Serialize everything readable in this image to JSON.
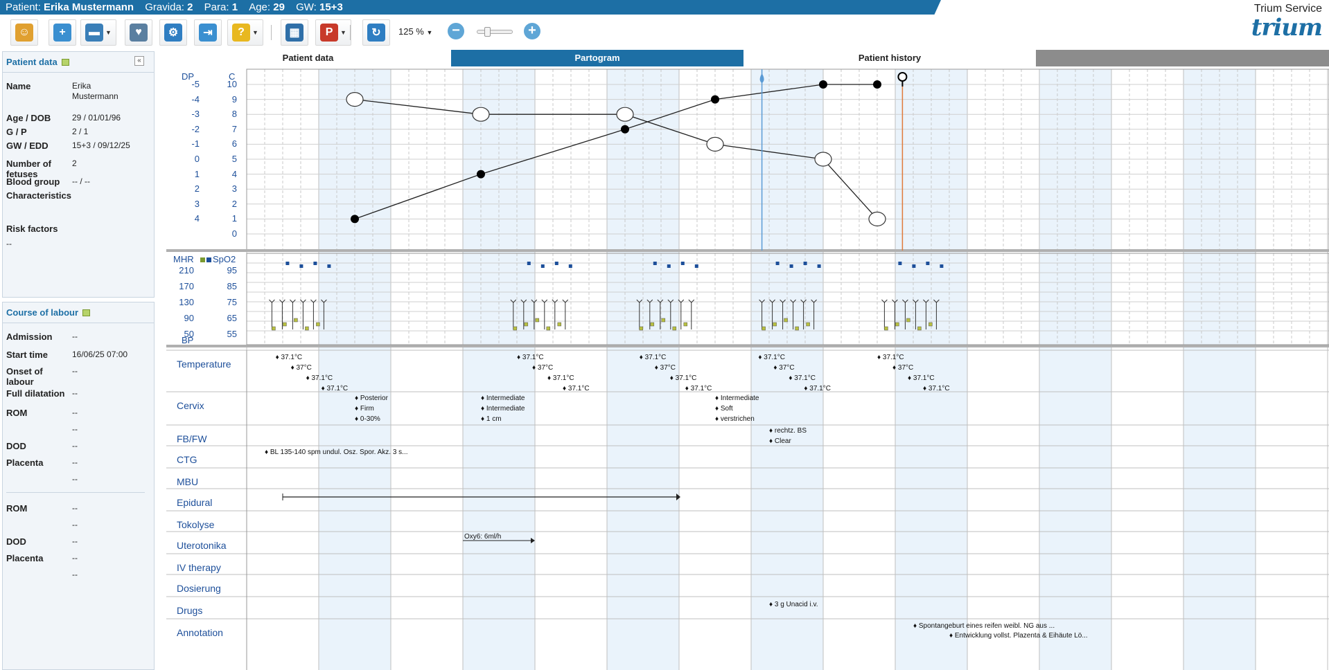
{
  "header": {
    "patient_label": "Patient:",
    "patient_name": "Erika Mustermann",
    "gravida_label": "Gravida:",
    "gravida": "2",
    "para_label": "Para:",
    "para": "1",
    "age_label": "Age:",
    "age": "29",
    "gw_label": "GW:",
    "gw": "15+3",
    "service": "Trium Service",
    "logo": "trium"
  },
  "toolbar": {
    "zoom": "125 %",
    "buttons": [
      {
        "name": "patients-icon",
        "color": "#e0a030"
      },
      {
        "name": "add-patient-icon",
        "color": "#3a8fd0"
      },
      {
        "name": "archive-icon",
        "color": "#3a7fb8"
      },
      {
        "name": "stethoscope-icon",
        "color": "#5a7fa0"
      },
      {
        "name": "gear-icon",
        "color": "#2f7ec2"
      },
      {
        "name": "logout-icon",
        "color": "#3a8fd0"
      },
      {
        "name": "help-icon",
        "color": "#e8b820"
      },
      {
        "name": "calendar-icon",
        "color": "#2f6fa8"
      },
      {
        "name": "pdf-icon",
        "color": "#c83a2a"
      },
      {
        "name": "refresh-icon",
        "color": "#2f7ec2"
      }
    ],
    "pdf_label": "PDF"
  },
  "patient_panel": {
    "title": "Patient data",
    "rows": [
      {
        "label": "Name",
        "value": "Erika\nMustermann"
      },
      {
        "label": "Age / DOB",
        "value": "29 / 01/01/96"
      },
      {
        "label": "G / P",
        "value": "2 / 1"
      },
      {
        "label": "GW / EDD",
        "value": "15+3 / 09/12/25"
      },
      {
        "label": "Number of fetuses",
        "value": "2"
      },
      {
        "label": "Blood group",
        "value": "-- / --"
      },
      {
        "label": "Characteristics",
        "value": ""
      },
      {
        "label": "Risk factors",
        "value": ""
      }
    ],
    "risk_value": "--"
  },
  "labour_panel": {
    "title": "Course of labour",
    "rows": [
      {
        "label": "Admission",
        "value": "--"
      },
      {
        "label": "Start time",
        "value": "16/06/25 07:00"
      },
      {
        "label": "Onset of labour",
        "value": "--"
      },
      {
        "label": "Full dilatation",
        "value": "--"
      },
      {
        "label": "ROM",
        "value": "--"
      },
      {
        "label": "",
        "value": "--"
      },
      {
        "label": "DOD",
        "value": "--"
      },
      {
        "label": "Placenta",
        "value": "--"
      },
      {
        "label": "",
        "value": "--"
      },
      {
        "label": "ROM",
        "value": "--"
      },
      {
        "label": "",
        "value": "--"
      },
      {
        "label": "DOD",
        "value": "--"
      },
      {
        "label": "Placenta",
        "value": "--"
      },
      {
        "label": "",
        "value": "--"
      }
    ]
  },
  "tabs": [
    {
      "label": "Patient data",
      "active": false
    },
    {
      "label": "Partogram",
      "active": true
    },
    {
      "label": "Patient history",
      "active": false
    }
  ],
  "partogram": {
    "dp_label": "DP",
    "c_label": "C",
    "dp_ticks": [
      "-5",
      "-4",
      "-3",
      "-2",
      "-1",
      "0",
      "1",
      "2",
      "3",
      "4"
    ],
    "c_ticks": [
      "10",
      "9",
      "8",
      "7",
      "6",
      "5",
      "4",
      "3",
      "2",
      "1",
      "0"
    ],
    "dilatation": [
      {
        "t": 1.5,
        "c": 1
      },
      {
        "t": 3.25,
        "c": 4
      },
      {
        "t": 5.25,
        "c": 7
      },
      {
        "t": 6.5,
        "c": 9
      },
      {
        "t": 8,
        "c": 10
      },
      {
        "t": 8.75,
        "c": 10
      }
    ],
    "descent": [
      {
        "t": 1.5,
        "c": 9
      },
      {
        "t": 3.25,
        "c": 8
      },
      {
        "t": 5.25,
        "c": 8
      },
      {
        "t": 6.5,
        "c": 6
      },
      {
        "t": 8,
        "c": 5
      },
      {
        "t": 8.75,
        "c": 1
      }
    ],
    "birth_marker_t": 9.1,
    "rom_marker_t": 7.15
  },
  "vitals": {
    "mhr_label": "MHR",
    "spo2_label": "SpO2",
    "bp_label": "BP",
    "mhr_ticks": [
      "210",
      "170",
      "130",
      "90",
      "50"
    ],
    "spo2_ticks": [
      "95",
      "85",
      "75",
      "65",
      "55"
    ]
  },
  "rows": [
    {
      "label": "Temperature"
    },
    {
      "label": "Cervix"
    },
    {
      "label": "FB/FW"
    },
    {
      "label": "CTG"
    },
    {
      "label": "MBU"
    },
    {
      "label": "Epidural"
    },
    {
      "label": "Tokolyse"
    },
    {
      "label": "Uterotonika"
    },
    {
      "label": "IV therapy"
    },
    {
      "label": "Dosierung"
    },
    {
      "label": "Drugs"
    },
    {
      "label": "Annotation"
    }
  ],
  "temperature_groups": [
    {
      "t": 0.4,
      "values": [
        "37.1°C",
        "37°C",
        "37.1°C",
        "37.1°C"
      ]
    },
    {
      "t": 3.75,
      "values": [
        "37.1°C",
        "37°C",
        "37.1°C",
        "37.1°C"
      ]
    },
    {
      "t": 5.45,
      "values": [
        "37.1°C",
        "37°C",
        "37.1°C",
        "37.1°C"
      ]
    },
    {
      "t": 7.1,
      "values": [
        "37.1°C",
        "37°C",
        "37.1°C",
        "37.1°C"
      ]
    },
    {
      "t": 8.75,
      "values": [
        "37.1°C",
        "37°C",
        "37.1°C",
        "37.1°C"
      ]
    }
  ],
  "cervix_groups": [
    {
      "t": 1.5,
      "values": [
        "Posterior",
        "Firm",
        "0-30%"
      ]
    },
    {
      "t": 3.25,
      "values": [
        "Intermediate",
        "Intermediate",
        "1 cm"
      ]
    },
    {
      "t": 6.5,
      "values": [
        "Intermediate",
        "Soft",
        "verstrichen"
      ]
    }
  ],
  "fbfw": {
    "t": 7.25,
    "values": [
      "rechtz. BS",
      "Clear"
    ]
  },
  "ctg": "BL 135-140 spm undul. Osz. Spor. Akz. 3 s...",
  "uterotonika": "Oxy6: 6ml/h",
  "drugs": "3 g Unacid i.v.",
  "annotations": [
    "Spontangeburt eines reifen weibl. NG aus ...",
    "Entwicklung vollst. Plazenta & Eihäute Lö..."
  ],
  "colors": {
    "accent": "#1d6fa5",
    "band": "#eaf3fb",
    "grid": "#cfcfcf",
    "birth": "#e07a3a"
  }
}
